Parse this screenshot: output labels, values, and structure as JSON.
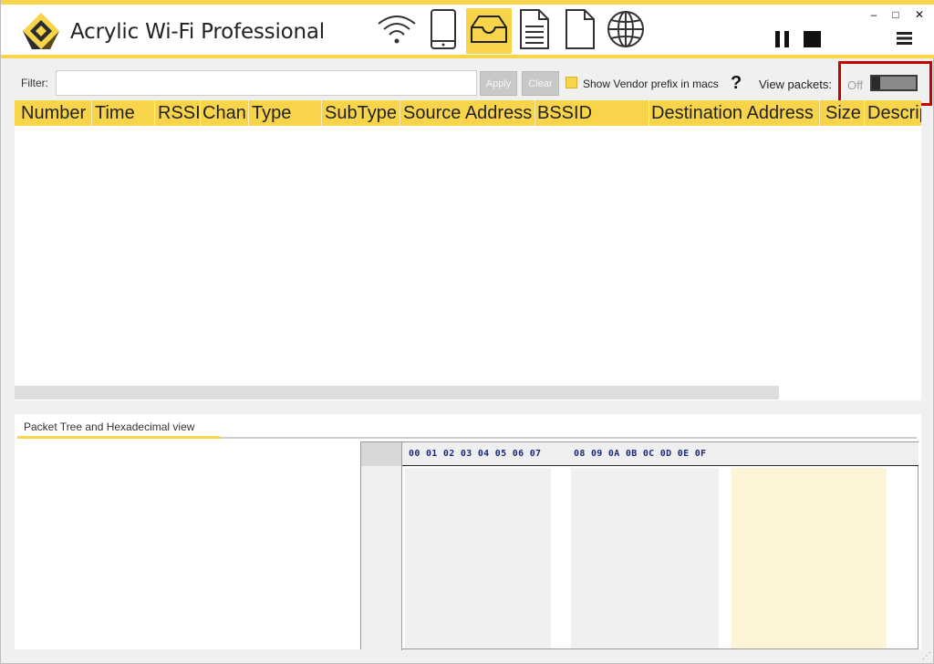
{
  "app": {
    "title": "Acrylic Wi-Fi Professional"
  },
  "nav": {
    "items": [
      {
        "name": "wifi-networks",
        "icon": "wifi-icon",
        "active": false
      },
      {
        "name": "mobile",
        "icon": "phone-icon",
        "active": false
      },
      {
        "name": "packets",
        "icon": "inbox-tray-icon",
        "active": true
      },
      {
        "name": "report",
        "icon": "document-lines-icon",
        "active": false
      },
      {
        "name": "blank-document",
        "icon": "document-icon",
        "active": false
      },
      {
        "name": "internet",
        "icon": "globe-icon",
        "active": false
      }
    ]
  },
  "toolbar": {
    "pause_icon": "pause-icon",
    "stop_icon": "stop-icon",
    "menu_icon": "hamburger-menu-icon"
  },
  "window": {
    "minimize": "–",
    "maximize": "□",
    "close": "✕"
  },
  "filter": {
    "label": "Filter:",
    "value": "",
    "apply_label": "Apply",
    "clear_label": "Clear",
    "vendor_label": "Show Vendor prefix in macs",
    "help": "?",
    "view_packets_label": "View packets:",
    "view_packets_state": "Off"
  },
  "table": {
    "columns": [
      "Number",
      "Time",
      "RSSI",
      "Chan",
      "Type",
      "SubType",
      "Source Address",
      "BSSID",
      "Destination Address",
      "Size",
      "Descrip"
    ],
    "rows": []
  },
  "lower": {
    "tab_label": "Packet Tree and Hexadecimal view",
    "hex_header_1": "00 01 02 03 04 05 06 07",
    "hex_header_2": "08 09 0A 0B 0C 0D 0E 0F"
  },
  "colors": {
    "accent": "#f8d44a",
    "highlight": "#c80000"
  }
}
